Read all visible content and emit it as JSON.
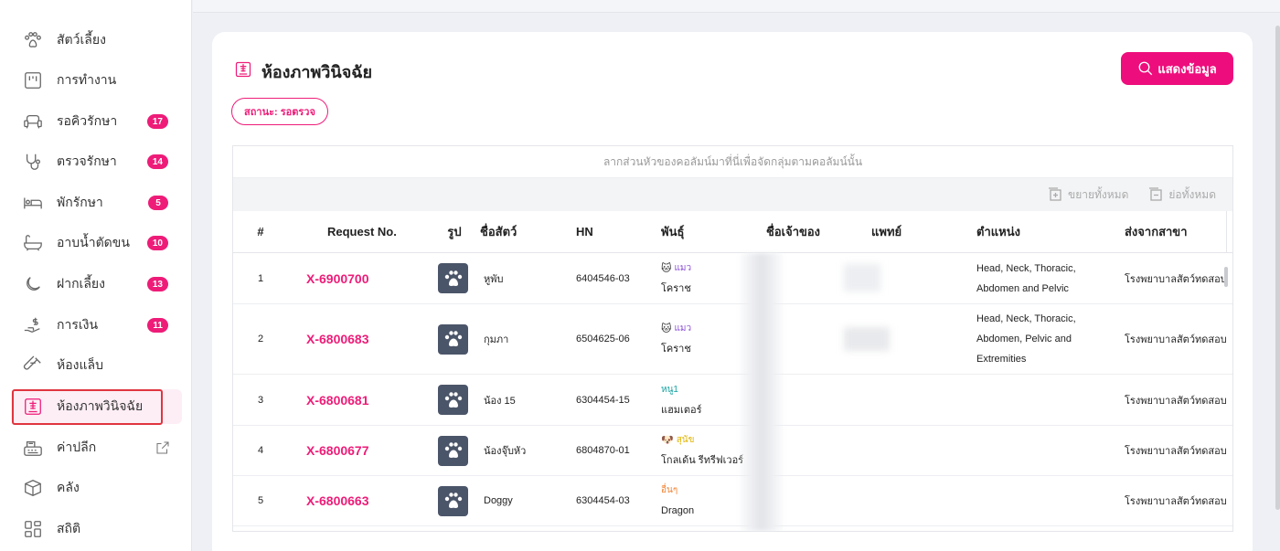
{
  "sidebar": {
    "items": [
      {
        "label": "สัตว์เลี้ยง",
        "icon": "paw-icon",
        "badge": ""
      },
      {
        "label": "การทำงาน",
        "icon": "kanban-icon",
        "badge": ""
      },
      {
        "label": "รอคิวรักษา",
        "icon": "sofa-icon",
        "badge": "17"
      },
      {
        "label": "ตรวจรักษา",
        "icon": "stethoscope-icon",
        "badge": "14"
      },
      {
        "label": "พักรักษา",
        "icon": "bed-icon",
        "badge": "5"
      },
      {
        "label": "อาบน้ำตัดขน",
        "icon": "bathtub-icon",
        "badge": "10"
      },
      {
        "label": "ฝากเลี้ยง",
        "icon": "moon-icon",
        "badge": "13"
      },
      {
        "label": "การเงิน",
        "icon": "money-hand-icon",
        "badge": "11"
      },
      {
        "label": "ห้องแล็บ",
        "icon": "test-tube-icon",
        "badge": ""
      },
      {
        "label": "ห้องภาพวินิจฉัย",
        "icon": "xray-icon",
        "badge": ""
      },
      {
        "label": "ค่าปลีก",
        "icon": "cash-register-icon",
        "badge": ""
      },
      {
        "label": "คลัง",
        "icon": "box-icon",
        "badge": ""
      },
      {
        "label": "สถิติ",
        "icon": "grid-stats-icon",
        "badge": ""
      }
    ]
  },
  "page": {
    "title": "ห้องภาพวินิจฉัย",
    "show_button": "แสดงข้อมูล",
    "status_filter": "สถานะ: รอตรวจ"
  },
  "grid": {
    "group_hint": "ลากส่วนหัวของคอลัมน์มาที่นี่เพื่อจัดกลุ่มตามคอลัมน์นั้น",
    "expand_all": "ขยายทั้งหมด",
    "collapse_all": "ย่อทั้งหมด",
    "columns": [
      "#",
      "Request No.",
      "รูป",
      "ชื่อสัตว์",
      "HN",
      "พันธุ์",
      "ชื่อเจ้าของ",
      "แพทย์",
      "ตำแหน่ง",
      "ส่งจากสาขา"
    ],
    "rows": [
      {
        "num": "1",
        "request": "X-6900700",
        "name": "หูพับ",
        "hn": "6404546-03",
        "species": "แมว",
        "species_icon": "cat-emoji",
        "species_color": "#8a4fd6",
        "breed": "โคราช",
        "position": [
          "Head, Neck, Thoracic,",
          "Abdomen and Pelvic"
        ],
        "branch": "โรงพยาบาลสัตว์ทดสอบ"
      },
      {
        "num": "2",
        "request": "X-6800683",
        "name": "กุมภา",
        "hn": "6504625-06",
        "species": "แมว",
        "species_icon": "cat-emoji",
        "species_color": "#8a4fd6",
        "breed": "โคราช",
        "position": [
          "Head, Neck, Thoracic,",
          "Abdomen, Pelvic and",
          "Extremities"
        ],
        "branch": "โรงพยาบาลสัตว์ทดสอบ"
      },
      {
        "num": "3",
        "request": "X-6800681",
        "name": "น้อง 15",
        "hn": "6304454-15",
        "species": "หนู1",
        "species_icon": "",
        "species_color": "#17a2a2",
        "breed": "แฮมเตอร์",
        "position": [],
        "branch": "โรงพยาบาลสัตว์ทดสอบ"
      },
      {
        "num": "4",
        "request": "X-6800677",
        "name": "น้องจุ๊บหัว",
        "hn": "6804870-01",
        "species": "สุนัข",
        "species_icon": "dog-emoji",
        "species_color": "#e0b400",
        "breed": "โกลเด้น รีทรีฟเวอร์",
        "position": [],
        "branch": "โรงพยาบาลสัตว์ทดสอบ"
      },
      {
        "num": "5",
        "request": "X-6800663",
        "name": "Doggy",
        "hn": "6304454-03",
        "species": "อื่นๆ",
        "species_icon": "",
        "species_color": "#f08030",
        "breed": "Dragon",
        "position": [],
        "branch": "โรงพยาบาลสัตว์ทดสอบ"
      }
    ]
  }
}
